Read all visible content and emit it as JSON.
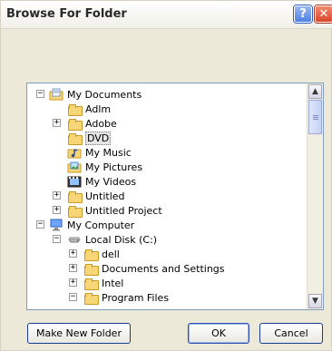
{
  "dialog": {
    "title": "Browse For Folder",
    "help_glyph": "?",
    "close_glyph": "✕"
  },
  "tree": {
    "items": [
      {
        "label": "My Documents",
        "expander": "−",
        "icon": "my-documents-icon"
      },
      {
        "label": "Adlm",
        "expander": "",
        "icon": "folder-icon"
      },
      {
        "label": "Adobe",
        "expander": "+",
        "icon": "folder-icon"
      },
      {
        "label": "DVD",
        "expander": "",
        "icon": "folder-icon",
        "selected": true
      },
      {
        "label": "My Music",
        "expander": "",
        "icon": "music-folder-icon"
      },
      {
        "label": "My Pictures",
        "expander": "",
        "icon": "pictures-folder-icon"
      },
      {
        "label": "My Videos",
        "expander": "",
        "icon": "videos-folder-icon"
      },
      {
        "label": "Untitled",
        "expander": "+",
        "icon": "folder-icon"
      },
      {
        "label": "Untitled Project",
        "expander": "+",
        "icon": "folder-icon"
      },
      {
        "label": "My Computer",
        "expander": "−",
        "icon": "computer-icon"
      },
      {
        "label": "Local Disk (C:)",
        "expander": "−",
        "icon": "drive-icon"
      },
      {
        "label": "dell",
        "expander": "+",
        "icon": "folder-icon"
      },
      {
        "label": "Documents and Settings",
        "expander": "+",
        "icon": "folder-icon"
      },
      {
        "label": "Intel",
        "expander": "+",
        "icon": "folder-icon"
      },
      {
        "label": "Program Files",
        "expander": "−",
        "icon": "folder-icon"
      }
    ]
  },
  "buttons": {
    "make_new_folder": "Make New Folder",
    "ok": "OK",
    "cancel": "Cancel"
  },
  "scroll": {
    "up_glyph": "▲",
    "down_glyph": "▼"
  }
}
